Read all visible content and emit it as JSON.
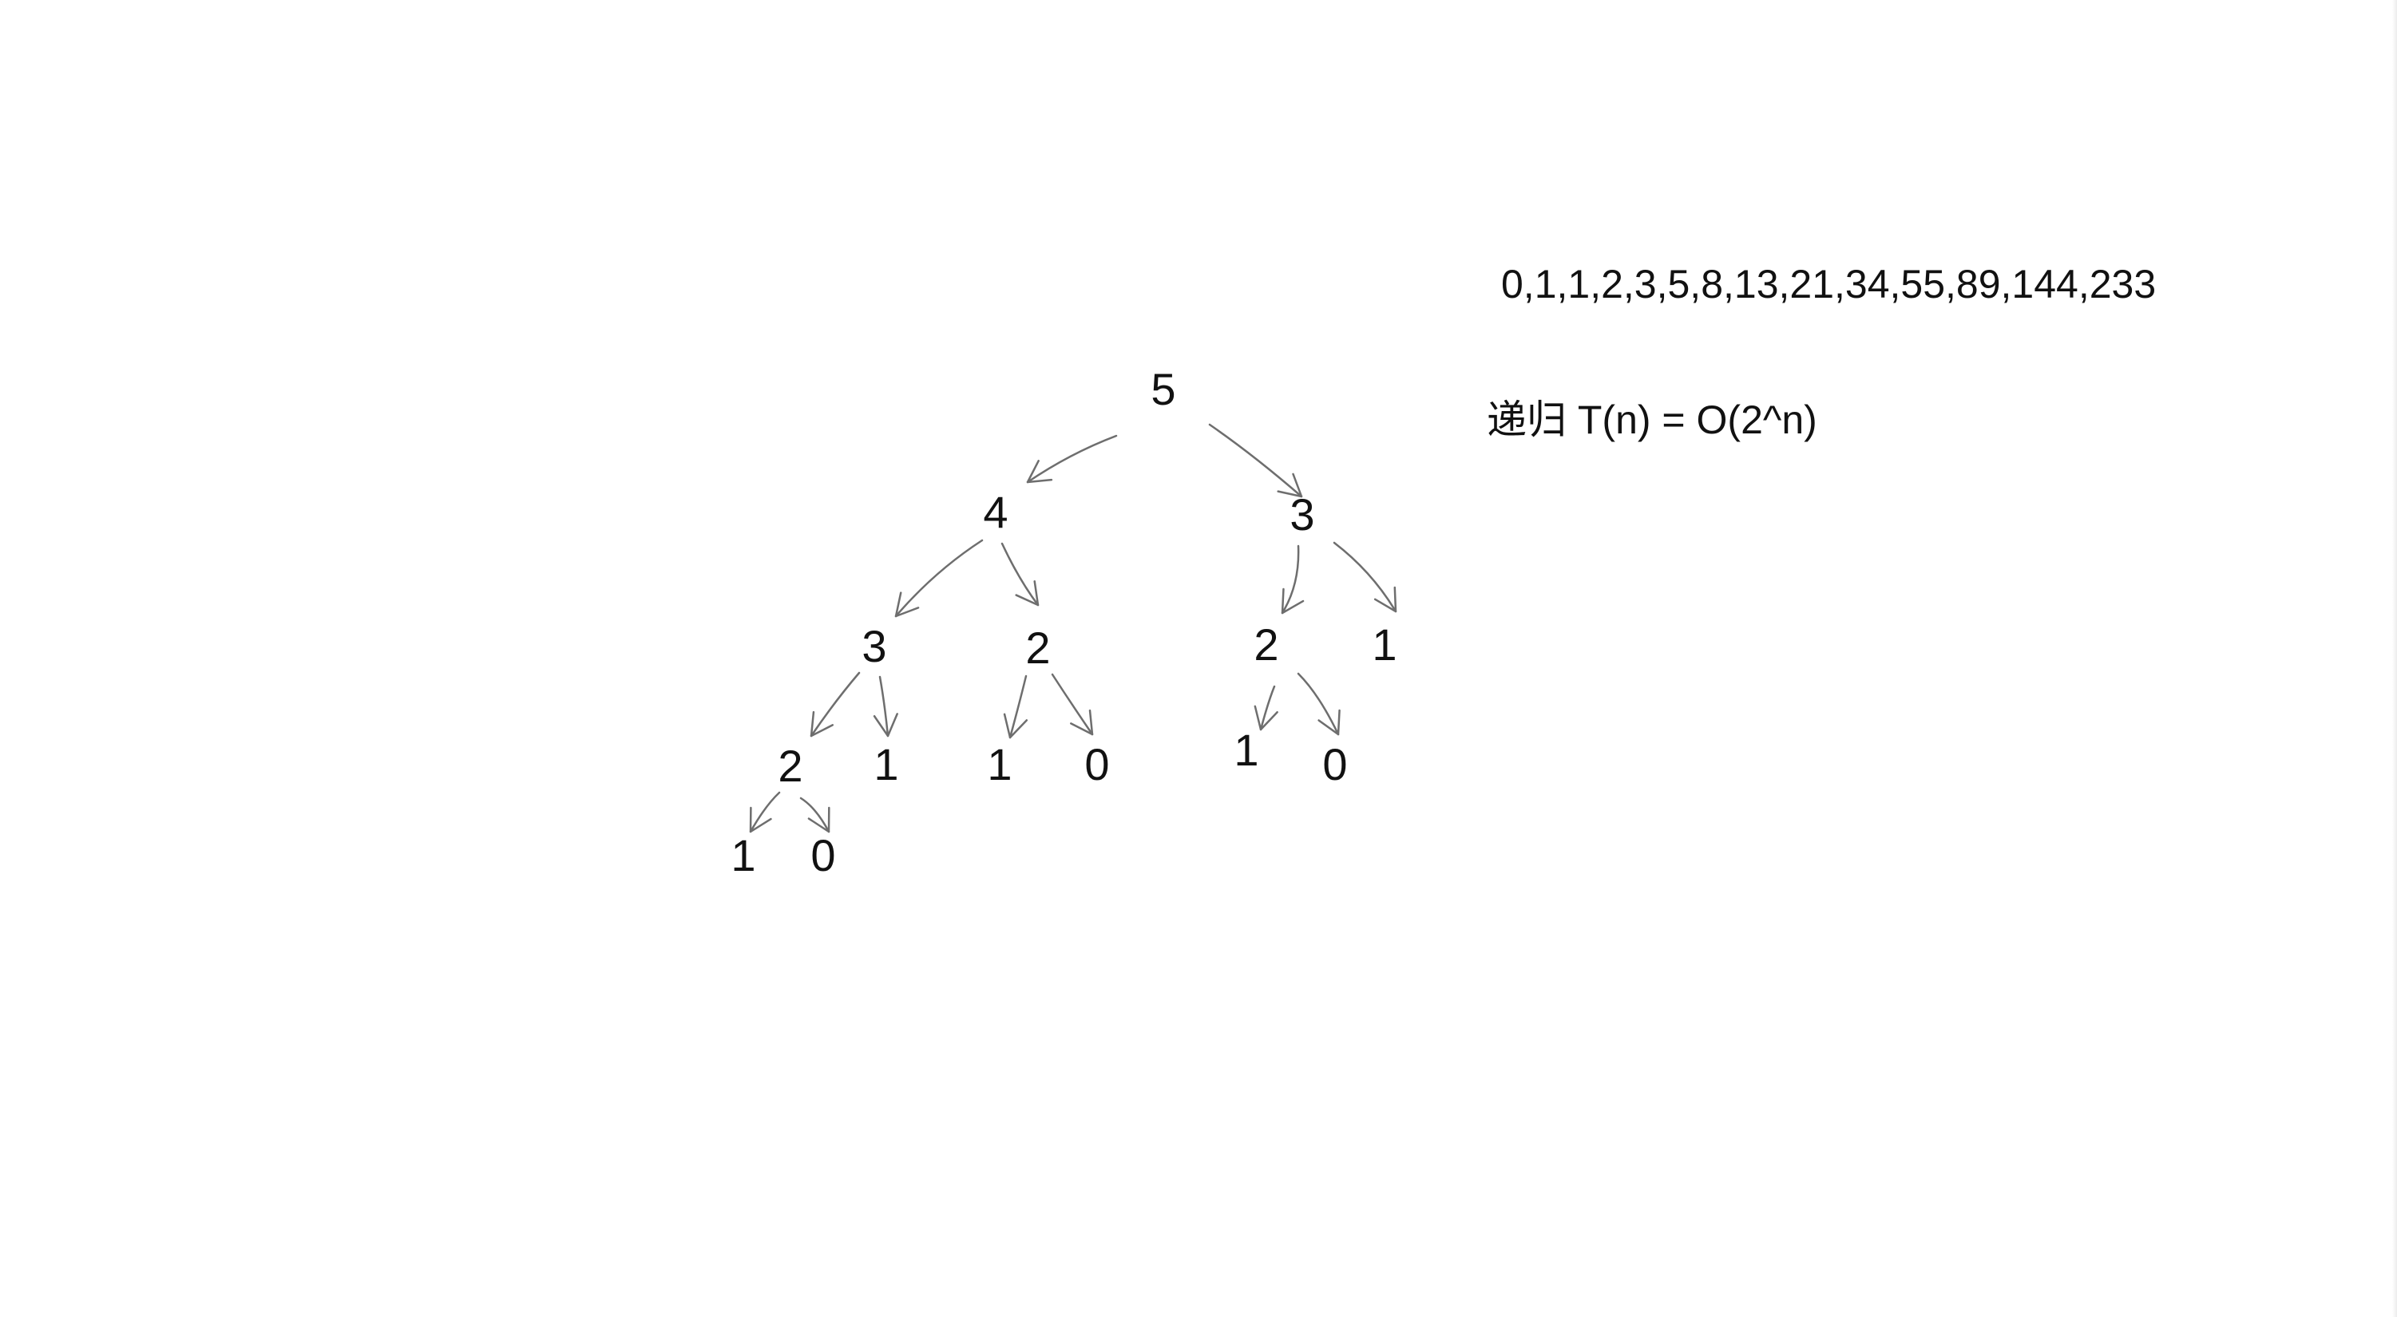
{
  "sequence": "0,1,1,2,3,5,8,13,21,34,55,89,144,233",
  "complexity": "递归 T(n) = O(2^n)",
  "tree": {
    "nodes": [
      {
        "id": "n5",
        "label": "5"
      },
      {
        "id": "n4",
        "label": "4"
      },
      {
        "id": "n3a",
        "label": "3"
      },
      {
        "id": "n3b",
        "label": "3"
      },
      {
        "id": "n2a",
        "label": "2"
      },
      {
        "id": "n2b",
        "label": "2"
      },
      {
        "id": "n1a",
        "label": "1"
      },
      {
        "id": "n2c",
        "label": "2"
      },
      {
        "id": "n1b",
        "label": "1"
      },
      {
        "id": "n1c",
        "label": "1"
      },
      {
        "id": "n0a",
        "label": "0"
      },
      {
        "id": "n1d",
        "label": "1"
      },
      {
        "id": "n0b",
        "label": "0"
      },
      {
        "id": "n1e",
        "label": "1"
      },
      {
        "id": "n0c",
        "label": "0"
      }
    ],
    "edges": [
      {
        "from": "n5",
        "to": "n4"
      },
      {
        "from": "n5",
        "to": "n3b"
      },
      {
        "from": "n4",
        "to": "n3a"
      },
      {
        "from": "n4",
        "to": "n2b"
      },
      {
        "from": "n3b",
        "to": "n2a"
      },
      {
        "from": "n3b",
        "to": "n1a"
      },
      {
        "from": "n3a",
        "to": "n2c"
      },
      {
        "from": "n3a",
        "to": "n1b"
      },
      {
        "from": "n2b",
        "to": "n1c"
      },
      {
        "from": "n2b",
        "to": "n0a"
      },
      {
        "from": "n2a",
        "to": "n1d"
      },
      {
        "from": "n2a",
        "to": "n0b"
      },
      {
        "from": "n2c",
        "to": "n1e"
      },
      {
        "from": "n2c",
        "to": "n0c"
      }
    ]
  },
  "colors": {
    "text": "#111111",
    "stroke": "#6e6e6e",
    "background": "#ffffff"
  }
}
